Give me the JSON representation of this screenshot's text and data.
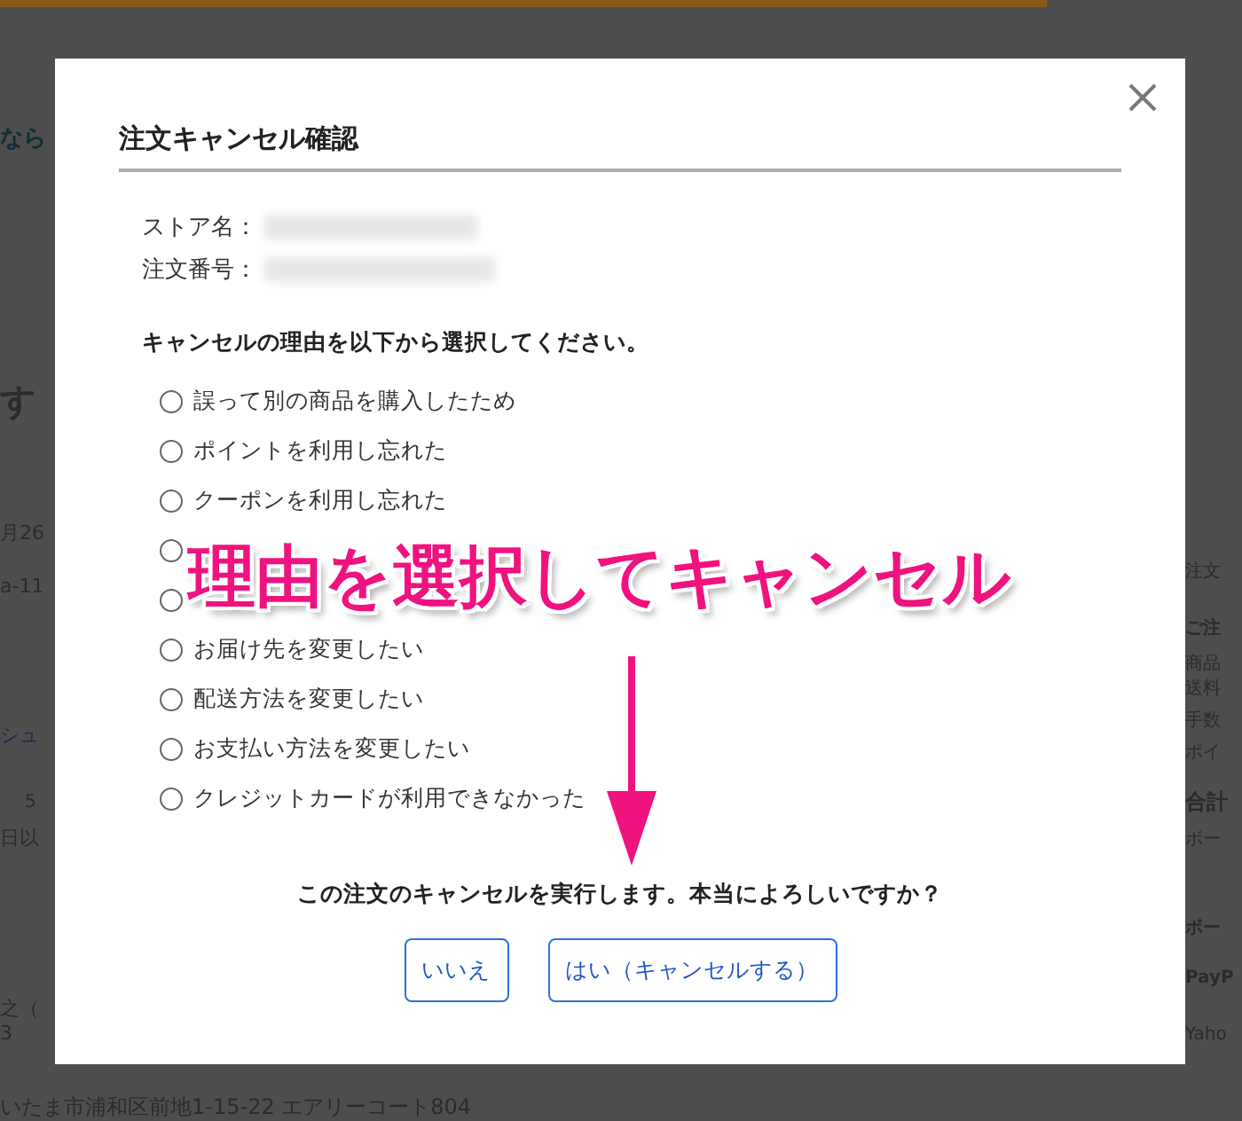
{
  "background_page": {
    "left_texts": [
      {
        "text": "なら",
        "kind": "teal-heading"
      },
      {
        "text": "す",
        "kind": "heading"
      },
      {
        "text": "月26",
        "kind": "text"
      },
      {
        "text": "a-11",
        "kind": "text"
      },
      {
        "text": "シュ",
        "kind": "link"
      },
      {
        "text": "5",
        "kind": "small"
      },
      {
        "text": "日以",
        "kind": "text"
      },
      {
        "text": "之（",
        "kind": "text"
      },
      {
        "text": "3",
        "kind": "text"
      }
    ],
    "address": "いたま市浦和区前地1-15-22 エアリーコート804",
    "right_texts": [
      {
        "text": "注文",
        "kind": "text"
      },
      {
        "text": "ご注",
        "kind": "bold"
      },
      {
        "text": "商品",
        "kind": "text"
      },
      {
        "text": "送料",
        "kind": "text"
      },
      {
        "text": "手数",
        "kind": "text"
      },
      {
        "text": "ポイ",
        "kind": "text"
      },
      {
        "text": "合計",
        "kind": "bold-large"
      },
      {
        "text": "ボー",
        "kind": "text"
      },
      {
        "text": "ボー",
        "kind": "bold"
      },
      {
        "text": "PayP",
        "kind": "bold"
      },
      {
        "text": "Yaho",
        "kind": "text"
      }
    ]
  },
  "dialog": {
    "title": "注文キャンセル確認",
    "fields": [
      {
        "label": "ストア名："
      },
      {
        "label": "注文番号："
      }
    ],
    "prompt": "キャンセルの理由を以下から選択してください。",
    "reasons": [
      {
        "label": "誤って別の商品を購入したため",
        "selected": false
      },
      {
        "label": "ポイントを利用し忘れた",
        "selected": false
      },
      {
        "label": "クーポンを利用し忘れた",
        "selected": false
      },
      {
        "selected": false
      },
      {
        "selected": false
      },
      {
        "label": "お届け先を変更したい",
        "selected": false
      },
      {
        "label": "配送方法を変更したい",
        "selected": false
      },
      {
        "label": "お支払い方法を変更したい",
        "selected": false
      },
      {
        "label": "クレジットカードが利用できなかった",
        "selected": false
      }
    ],
    "confirm_text": "この注文のキャンセルを実行します。本当によろしいですか？",
    "buttons": [
      "いいえ",
      "はい（キャンセルする）"
    ]
  },
  "annotation": {
    "text": "理由を選択してキャンセル"
  }
}
